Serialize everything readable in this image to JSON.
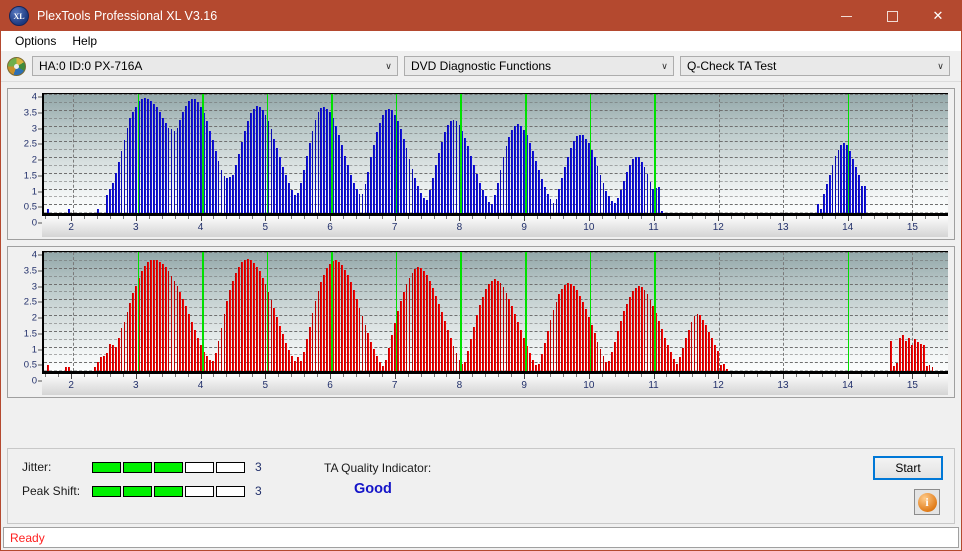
{
  "window": {
    "title": "PlexTools Professional XL V3.16",
    "icon": "XL",
    "minimize": "—",
    "maximize": "□",
    "close": "✕"
  },
  "menu": {
    "items": [
      "Options",
      "Help"
    ]
  },
  "toolbar": {
    "drive_icon": "disc-icon",
    "drive": "HA:0 ID:0  PX-716A",
    "function": "DVD Diagnostic Functions",
    "test": "Q-Check TA Test",
    "arrow": "∨"
  },
  "footer": {
    "jitter_label": "Jitter:",
    "jitter_value": "3",
    "jitter_segments": 3,
    "peak_shift_label": "Peak Shift:",
    "peak_shift_value": "3",
    "peak_shift_segments": 3,
    "total_segments": 5,
    "tqi_label": "TA Quality Indicator:",
    "tqi_value": "Good",
    "start_label": "Start",
    "info_glyph": "i"
  },
  "statusbar": {
    "text": "Ready"
  },
  "colors": {
    "titlebar": "#b4492f",
    "blue_bar": "#1414e0",
    "red_bar": "#fa0505",
    "marker_green": "#00e000",
    "good_text": "#1414c8",
    "status_text": "#ff2020",
    "focus_blue": "#0078d7"
  },
  "chart_data": [
    {
      "type": "bar",
      "id": "jitter-chart",
      "title": "",
      "series_name": "Jitter",
      "color": "#1414e0",
      "xlabel": "",
      "ylabel": "",
      "xlim": [
        1.55,
        15.55
      ],
      "ylim": [
        0,
        4
      ],
      "ytick_labels": [
        "0",
        "0.5",
        "1",
        "1.5",
        "2",
        "2.5",
        "3",
        "3.5",
        "4"
      ],
      "ytick_values": [
        0,
        0.5,
        1,
        1.5,
        2,
        2.5,
        3,
        3.5,
        4
      ],
      "xtick_labels": [
        "2",
        "3",
        "4",
        "5",
        "6",
        "7",
        "8",
        "9",
        "10",
        "11",
        "12",
        "13",
        "14",
        "15"
      ],
      "xtick_values": [
        2,
        3,
        4,
        5,
        6,
        7,
        8,
        9,
        10,
        11,
        12,
        13,
        14,
        15
      ],
      "grid": true,
      "markers": [
        3,
        4,
        5,
        6,
        7,
        8,
        9,
        10,
        11,
        14
      ],
      "bar_x_start": 1.6,
      "bar_x_step": 0.0455,
      "values": [
        0.1,
        0,
        0,
        0,
        0,
        0,
        0,
        0.12,
        0,
        0,
        0,
        0,
        0,
        0,
        0,
        0,
        0,
        0.1,
        0,
        0,
        0.55,
        0.75,
        0.95,
        1.25,
        1.6,
        1.95,
        2.3,
        2.7,
        3.0,
        3.2,
        3.35,
        3.55,
        3.62,
        3.65,
        3.62,
        3.55,
        3.45,
        3.35,
        3.2,
        3.0,
        2.85,
        2.7,
        2.65,
        2.6,
        2.7,
        2.95,
        3.2,
        3.4,
        3.55,
        3.62,
        3.6,
        3.5,
        3.35,
        3.15,
        2.9,
        2.6,
        2.3,
        1.95,
        1.65,
        1.35,
        1.15,
        1.1,
        1.12,
        1.2,
        1.5,
        1.85,
        2.25,
        2.6,
        2.9,
        3.15,
        3.3,
        3.38,
        3.35,
        3.25,
        3.1,
        2.9,
        2.65,
        2.35,
        2.05,
        1.75,
        1.45,
        1.2,
        0.95,
        0.72,
        0.55,
        0.62,
        0.95,
        1.35,
        1.8,
        2.2,
        2.6,
        2.95,
        3.2,
        3.32,
        3.35,
        3.3,
        3.18,
        3.0,
        2.75,
        2.45,
        2.15,
        1.8,
        1.5,
        1.2,
        0.95,
        0.75,
        0.6,
        0.58,
        0.9,
        1.3,
        1.75,
        2.15,
        2.55,
        2.85,
        3.1,
        3.25,
        3.3,
        3.25,
        3.1,
        2.9,
        2.65,
        2.35,
        2.05,
        1.7,
        1.4,
        1.1,
        0.85,
        0.62,
        0.45,
        0.4,
        0.72,
        1.1,
        1.5,
        1.9,
        2.25,
        2.55,
        2.78,
        2.92,
        2.95,
        2.9,
        2.78,
        2.6,
        2.38,
        2.1,
        1.8,
        1.5,
        1.22,
        0.95,
        0.72,
        0.52,
        0.35,
        0.28,
        0.55,
        0.95,
        1.35,
        1.75,
        2.1,
        2.4,
        2.62,
        2.75,
        2.8,
        2.75,
        2.62,
        2.45,
        2.22,
        1.95,
        1.65,
        1.35,
        1.08,
        0.82,
        0.6,
        0.42,
        0.3,
        0.42,
        0.75,
        1.1,
        1.45,
        1.78,
        2.05,
        2.28,
        2.42,
        2.48,
        2.45,
        2.35,
        2.2,
        2.0,
        1.75,
        1.48,
        1.2,
        0.95,
        0.7,
        0.52,
        0.38,
        0.3,
        0.45,
        0.72,
        1.0,
        1.28,
        1.52,
        1.7,
        1.78,
        1.75,
        1.62,
        1.45,
        1.22,
        0.98,
        0.75,
        0.78,
        0.8,
        0.05,
        0,
        0,
        0,
        0,
        0,
        0,
        0,
        0,
        0,
        0,
        0,
        0,
        0,
        0,
        0,
        0,
        0,
        0,
        0,
        0,
        0,
        0,
        0,
        0,
        0,
        0,
        0,
        0,
        0,
        0,
        0,
        0,
        0,
        0,
        0,
        0,
        0,
        0,
        0,
        0,
        0,
        0,
        0,
        0,
        0,
        0,
        0,
        0,
        0,
        0,
        0,
        0,
        0.28,
        0.1,
        0.6,
        0.9,
        1.2,
        1.5,
        1.8,
        2.0,
        2.15,
        2.22,
        2.15,
        1.95,
        1.7,
        1.45,
        1.2,
        0.85,
        0.85,
        0,
        0,
        0,
        0,
        0,
        0,
        0,
        0,
        0,
        0,
        0,
        0,
        0,
        0,
        0,
        0,
        0,
        0,
        0,
        0,
        0,
        0,
        0,
        0
      ]
    },
    {
      "type": "bar",
      "id": "peak-shift-chart",
      "title": "",
      "series_name": "Peak Shift",
      "color": "#fa0505",
      "xlabel": "",
      "ylabel": "",
      "xlim": [
        1.55,
        15.55
      ],
      "ylim": [
        0,
        4
      ],
      "ytick_labels": [
        "0",
        "0.5",
        "1",
        "1.5",
        "2",
        "2.5",
        "3",
        "3.5",
        "4"
      ],
      "ytick_values": [
        0,
        0.5,
        1,
        1.5,
        2,
        2.5,
        3,
        3.5,
        4
      ],
      "xtick_labels": [
        "2",
        "3",
        "4",
        "5",
        "6",
        "7",
        "8",
        "9",
        "10",
        "11",
        "12",
        "13",
        "14",
        "15"
      ],
      "xtick_values": [
        2,
        3,
        4,
        5,
        6,
        7,
        8,
        9,
        10,
        11,
        12,
        13,
        14,
        15
      ],
      "grid": true,
      "markers": [
        3,
        4,
        5,
        6,
        7,
        8,
        9,
        10,
        11,
        14
      ],
      "bar_x_start": 1.6,
      "bar_x_step": 0.0455,
      "values": [
        0.18,
        0,
        0,
        0,
        0,
        0,
        0.12,
        0.1,
        0,
        0,
        0,
        0,
        0,
        0,
        0,
        0,
        0.12,
        0.28,
        0.42,
        0.48,
        0.55,
        0.85,
        0.8,
        0.75,
        1.05,
        1.35,
        1.55,
        1.85,
        2.15,
        2.45,
        2.7,
        2.95,
        3.15,
        3.32,
        3.45,
        3.5,
        3.52,
        3.5,
        3.45,
        3.38,
        3.28,
        3.15,
        3.0,
        2.85,
        2.7,
        2.5,
        2.28,
        2.05,
        1.8,
        1.55,
        1.3,
        1.05,
        0.82,
        0.6,
        0.45,
        0.35,
        0.3,
        0.55,
        0.95,
        1.35,
        1.8,
        2.2,
        2.55,
        2.85,
        3.1,
        3.3,
        3.45,
        3.52,
        3.55,
        3.5,
        3.42,
        3.3,
        3.15,
        2.95,
        2.75,
        2.5,
        2.25,
        1.98,
        1.7,
        1.42,
        1.15,
        0.88,
        0.65,
        0.45,
        0.3,
        0.42,
        0.32,
        0.6,
        1.0,
        1.4,
        1.82,
        2.2,
        2.52,
        2.8,
        3.05,
        3.25,
        3.4,
        3.48,
        3.5,
        3.45,
        3.35,
        3.2,
        3.02,
        2.8,
        2.55,
        2.28,
        2.0,
        1.72,
        1.45,
        1.18,
        0.92,
        0.68,
        0.45,
        0.28,
        0.15,
        0.35,
        0.72,
        1.12,
        1.52,
        1.9,
        2.22,
        2.5,
        2.75,
        2.95,
        3.1,
        3.22,
        3.28,
        3.25,
        3.15,
        3.02,
        2.85,
        2.62,
        2.38,
        2.12,
        1.85,
        1.58,
        1.3,
        1.02,
        0.78,
        0.55,
        0.35,
        0.2,
        0.28,
        0.62,
        1.0,
        1.38,
        1.75,
        2.08,
        2.35,
        2.58,
        2.75,
        2.85,
        2.9,
        2.86,
        2.78,
        2.65,
        2.48,
        2.28,
        2.05,
        1.8,
        1.55,
        1.28,
        1.02,
        0.78,
        0.55,
        0.35,
        0.18,
        0.22,
        0.52,
        0.88,
        1.25,
        1.6,
        1.92,
        2.18,
        2.42,
        2.6,
        2.72,
        2.78,
        2.75,
        2.68,
        2.55,
        2.38,
        2.18,
        1.95,
        1.7,
        1.45,
        1.18,
        0.92,
        0.68,
        0.45,
        0.28,
        0.3,
        0.58,
        0.92,
        1.25,
        1.58,
        1.88,
        2.12,
        2.35,
        2.52,
        2.62,
        2.68,
        2.65,
        2.55,
        2.42,
        2.25,
        2.05,
        1.82,
        1.58,
        1.32,
        1.05,
        0.8,
        0.58,
        0.38,
        0.22,
        0.42,
        0.72,
        1.02,
        1.3,
        1.55,
        1.72,
        1.8,
        1.75,
        1.62,
        1.45,
        1.22,
        1.02,
        0.8,
        0.62,
        0.18,
        0.22,
        0.05,
        0,
        0,
        0,
        0,
        0,
        0,
        0,
        0,
        0,
        0,
        0,
        0,
        0,
        0,
        0,
        0,
        0,
        0,
        0,
        0,
        0,
        0,
        0,
        0,
        0,
        0,
        0,
        0,
        0,
        0,
        0,
        0,
        0,
        0,
        0,
        0,
        0,
        0,
        0,
        0,
        0,
        0,
        0,
        0,
        0,
        0,
        0,
        0,
        0,
        0,
        0,
        0,
        0,
        0,
        0,
        0.95,
        0.15,
        0.25,
        1.05,
        1.12,
        0.95,
        1.02,
        0.8,
        1.0,
        0.92,
        0.85,
        0.82,
        0.15,
        0.18,
        0.12,
        0,
        0,
        0,
        0,
        0,
        0,
        0,
        0,
        0,
        0,
        0,
        0,
        0,
        0,
        0,
        0,
        0,
        0,
        0,
        0,
        0,
        0,
        0,
        0
      ]
    }
  ]
}
